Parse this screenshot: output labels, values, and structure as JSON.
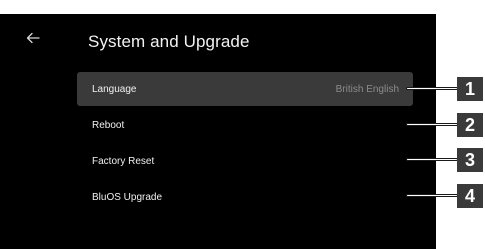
{
  "header": {
    "title": "System and Upgrade",
    "back_icon": "arrow-left-icon"
  },
  "menu": {
    "items": [
      {
        "label": "Language",
        "value": "British English",
        "selected": true
      },
      {
        "label": "Reboot",
        "value": ""
      },
      {
        "label": "Factory Reset",
        "value": ""
      },
      {
        "label": "BluOS Upgrade",
        "value": ""
      }
    ]
  },
  "callouts": [
    "1",
    "2",
    "3",
    "4"
  ],
  "colors": {
    "screen_bg": "#000000",
    "selected_row_bg": "#3a3a3a",
    "callout_bg": "#3a3a3a",
    "text": "#f0f0f0",
    "muted_text": "#8c8c8c"
  }
}
